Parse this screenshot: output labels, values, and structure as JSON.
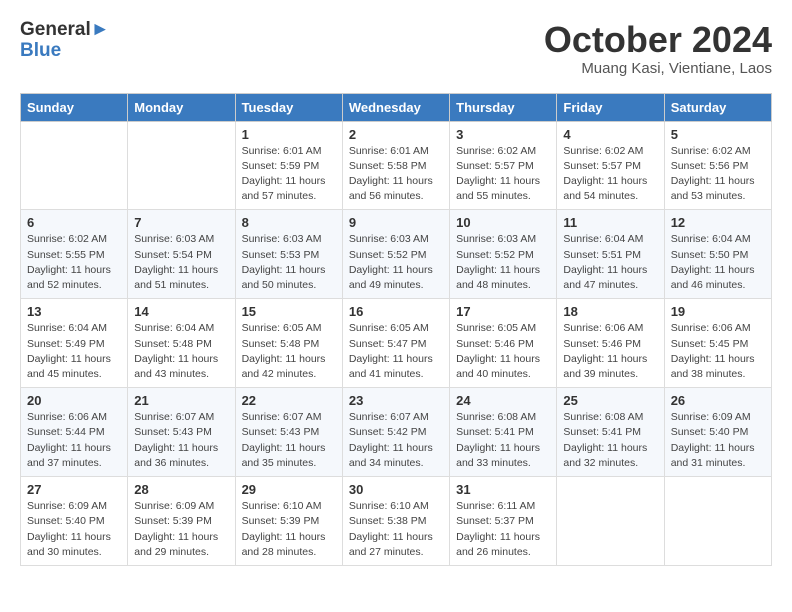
{
  "header": {
    "logo_line1": "General",
    "logo_line2": "Blue",
    "month": "October 2024",
    "location": "Muang Kasi, Vientiane, Laos"
  },
  "days_of_week": [
    "Sunday",
    "Monday",
    "Tuesday",
    "Wednesday",
    "Thursday",
    "Friday",
    "Saturday"
  ],
  "weeks": [
    [
      {
        "day": "",
        "info": ""
      },
      {
        "day": "",
        "info": ""
      },
      {
        "day": "1",
        "info": "Sunrise: 6:01 AM\nSunset: 5:59 PM\nDaylight: 11 hours and 57 minutes."
      },
      {
        "day": "2",
        "info": "Sunrise: 6:01 AM\nSunset: 5:58 PM\nDaylight: 11 hours and 56 minutes."
      },
      {
        "day": "3",
        "info": "Sunrise: 6:02 AM\nSunset: 5:57 PM\nDaylight: 11 hours and 55 minutes."
      },
      {
        "day": "4",
        "info": "Sunrise: 6:02 AM\nSunset: 5:57 PM\nDaylight: 11 hours and 54 minutes."
      },
      {
        "day": "5",
        "info": "Sunrise: 6:02 AM\nSunset: 5:56 PM\nDaylight: 11 hours and 53 minutes."
      }
    ],
    [
      {
        "day": "6",
        "info": "Sunrise: 6:02 AM\nSunset: 5:55 PM\nDaylight: 11 hours and 52 minutes."
      },
      {
        "day": "7",
        "info": "Sunrise: 6:03 AM\nSunset: 5:54 PM\nDaylight: 11 hours and 51 minutes."
      },
      {
        "day": "8",
        "info": "Sunrise: 6:03 AM\nSunset: 5:53 PM\nDaylight: 11 hours and 50 minutes."
      },
      {
        "day": "9",
        "info": "Sunrise: 6:03 AM\nSunset: 5:52 PM\nDaylight: 11 hours and 49 minutes."
      },
      {
        "day": "10",
        "info": "Sunrise: 6:03 AM\nSunset: 5:52 PM\nDaylight: 11 hours and 48 minutes."
      },
      {
        "day": "11",
        "info": "Sunrise: 6:04 AM\nSunset: 5:51 PM\nDaylight: 11 hours and 47 minutes."
      },
      {
        "day": "12",
        "info": "Sunrise: 6:04 AM\nSunset: 5:50 PM\nDaylight: 11 hours and 46 minutes."
      }
    ],
    [
      {
        "day": "13",
        "info": "Sunrise: 6:04 AM\nSunset: 5:49 PM\nDaylight: 11 hours and 45 minutes."
      },
      {
        "day": "14",
        "info": "Sunrise: 6:04 AM\nSunset: 5:48 PM\nDaylight: 11 hours and 43 minutes."
      },
      {
        "day": "15",
        "info": "Sunrise: 6:05 AM\nSunset: 5:48 PM\nDaylight: 11 hours and 42 minutes."
      },
      {
        "day": "16",
        "info": "Sunrise: 6:05 AM\nSunset: 5:47 PM\nDaylight: 11 hours and 41 minutes."
      },
      {
        "day": "17",
        "info": "Sunrise: 6:05 AM\nSunset: 5:46 PM\nDaylight: 11 hours and 40 minutes."
      },
      {
        "day": "18",
        "info": "Sunrise: 6:06 AM\nSunset: 5:46 PM\nDaylight: 11 hours and 39 minutes."
      },
      {
        "day": "19",
        "info": "Sunrise: 6:06 AM\nSunset: 5:45 PM\nDaylight: 11 hours and 38 minutes."
      }
    ],
    [
      {
        "day": "20",
        "info": "Sunrise: 6:06 AM\nSunset: 5:44 PM\nDaylight: 11 hours and 37 minutes."
      },
      {
        "day": "21",
        "info": "Sunrise: 6:07 AM\nSunset: 5:43 PM\nDaylight: 11 hours and 36 minutes."
      },
      {
        "day": "22",
        "info": "Sunrise: 6:07 AM\nSunset: 5:43 PM\nDaylight: 11 hours and 35 minutes."
      },
      {
        "day": "23",
        "info": "Sunrise: 6:07 AM\nSunset: 5:42 PM\nDaylight: 11 hours and 34 minutes."
      },
      {
        "day": "24",
        "info": "Sunrise: 6:08 AM\nSunset: 5:41 PM\nDaylight: 11 hours and 33 minutes."
      },
      {
        "day": "25",
        "info": "Sunrise: 6:08 AM\nSunset: 5:41 PM\nDaylight: 11 hours and 32 minutes."
      },
      {
        "day": "26",
        "info": "Sunrise: 6:09 AM\nSunset: 5:40 PM\nDaylight: 11 hours and 31 minutes."
      }
    ],
    [
      {
        "day": "27",
        "info": "Sunrise: 6:09 AM\nSunset: 5:40 PM\nDaylight: 11 hours and 30 minutes."
      },
      {
        "day": "28",
        "info": "Sunrise: 6:09 AM\nSunset: 5:39 PM\nDaylight: 11 hours and 29 minutes."
      },
      {
        "day": "29",
        "info": "Sunrise: 6:10 AM\nSunset: 5:39 PM\nDaylight: 11 hours and 28 minutes."
      },
      {
        "day": "30",
        "info": "Sunrise: 6:10 AM\nSunset: 5:38 PM\nDaylight: 11 hours and 27 minutes."
      },
      {
        "day": "31",
        "info": "Sunrise: 6:11 AM\nSunset: 5:37 PM\nDaylight: 11 hours and 26 minutes."
      },
      {
        "day": "",
        "info": ""
      },
      {
        "day": "",
        "info": ""
      }
    ]
  ]
}
